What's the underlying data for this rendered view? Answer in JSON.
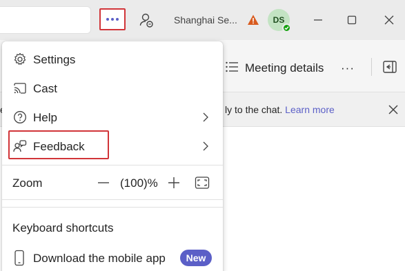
{
  "titlebar": {
    "org_name": "Shanghai Se...",
    "avatar_initials": "DS",
    "icons": [
      "more-icon",
      "presence-icon",
      "warning-icon",
      "minimize-icon",
      "maximize-icon",
      "close-icon"
    ]
  },
  "meeting": {
    "details_label": "Meeting details",
    "details_more": "···",
    "banner_prefix": "ly to the chat.",
    "banner_link": "Learn more",
    "left_fragment": "e"
  },
  "menu": {
    "items": [
      {
        "label": "Settings",
        "icon": "gear-icon"
      },
      {
        "label": "Cast",
        "icon": "cast-icon"
      },
      {
        "label": "Help",
        "icon": "help-icon"
      },
      {
        "label": "Feedback",
        "icon": "feedback-icon"
      }
    ],
    "zoom": {
      "label": "Zoom",
      "value": "(100)%"
    },
    "keyboard_shortcuts": "Keyboard shortcuts",
    "mobile_app": "Download the mobile app",
    "new_badge": "New"
  },
  "colors": {
    "accent": "#5b5fc7",
    "highlight_border": "#d13438",
    "warning": "#d85b1f",
    "presence_available": "#13a10e"
  }
}
